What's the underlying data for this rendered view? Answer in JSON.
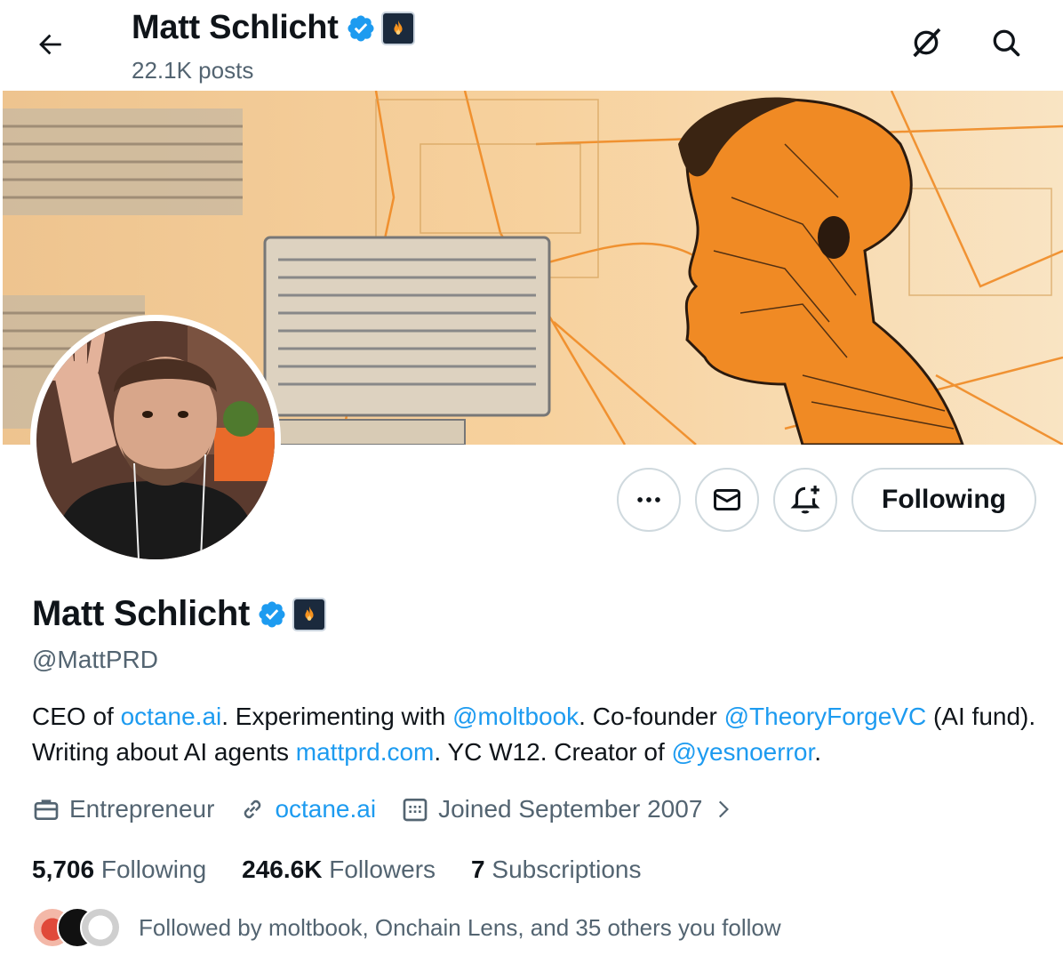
{
  "header": {
    "title": "Matt Schlicht",
    "posts": "22.1K posts"
  },
  "profile": {
    "name": "Matt Schlicht",
    "handle": "@MattPRD",
    "following_button": "Following"
  },
  "bio": {
    "t1": "CEO of ",
    "l1": "octane.ai",
    "t2": ". Experimenting with ",
    "l2": "@moltbook",
    "t3": ". Co-founder ",
    "l3": "@TheoryForgeVC",
    "t4": " (AI fund). Writing about AI agents ",
    "l4": "mattprd.com",
    "t5": ". YC W12. Creator of ",
    "l5": "@yesnoerror",
    "t6": "."
  },
  "meta": {
    "profession": "Entrepreneur",
    "website": "octane.ai",
    "joined": "Joined September 2007"
  },
  "stats": {
    "following_count": "5,706",
    "following_label": "Following",
    "followers_count": "246.6K",
    "followers_label": "Followers",
    "subscriptions_count": "7",
    "subscriptions_label": "Subscriptions"
  },
  "followed_by": "Followed by moltbook, Onchain Lens, and 35 others you follow",
  "icons": {
    "back": "arrow-left-icon",
    "grok": "grok-icon",
    "search": "search-icon",
    "more": "more-icon",
    "message": "message-icon",
    "notify": "bell-plus-icon",
    "verified": "verified-badge-icon",
    "affiliate": "affiliate-badge-icon"
  },
  "colors": {
    "accent": "#1d9bf0",
    "muted": "#536471",
    "banner_orange": "#f08a24"
  }
}
